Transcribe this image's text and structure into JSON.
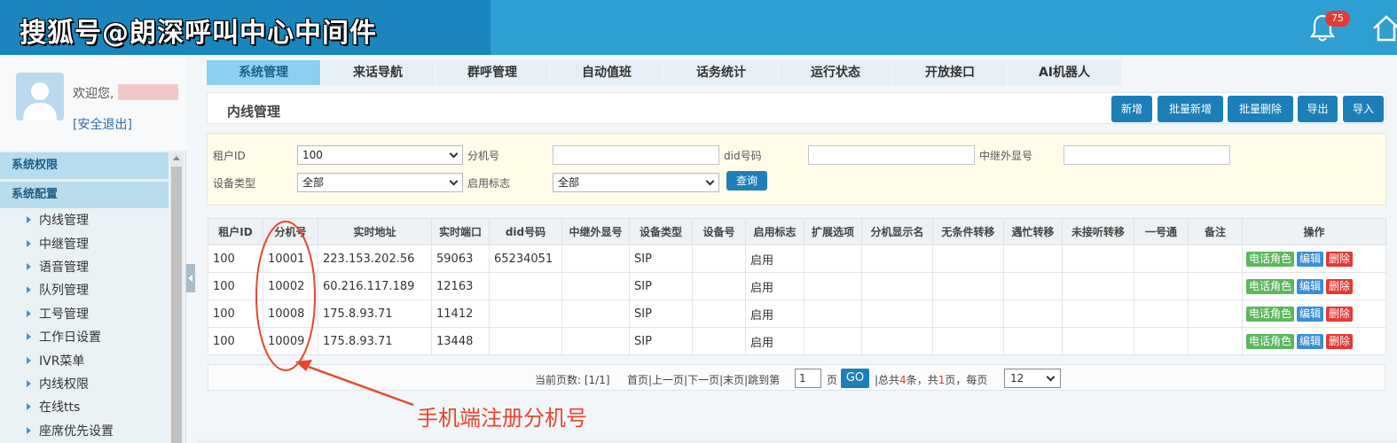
{
  "watermark": "搜狐号@朗深呼叫中心中间件",
  "notifications": {
    "count": "75"
  },
  "user": {
    "welcome": "欢迎您,",
    "logout": "[安全退出]"
  },
  "sidebar": {
    "sections": [
      "系统权限",
      "系统配置"
    ],
    "items": [
      "内线管理",
      "中继管理",
      "语音管理",
      "队列管理",
      "工号管理",
      "工作日设置",
      "IVR菜单",
      "内线权限",
      "在线tts",
      "座席优先设置"
    ]
  },
  "tabs": [
    "系统管理",
    "来话导航",
    "群呼管理",
    "自动值班",
    "话务统计",
    "运行状态",
    "开放接口",
    "AI机器人"
  ],
  "panel": {
    "title": "内线管理"
  },
  "toolbar": {
    "add": "新增",
    "batch_add": "批量新增",
    "batch_delete": "批量删除",
    "export": "导出",
    "import": "导入"
  },
  "filter": {
    "tenant_label": "租户ID",
    "tenant_value": "100",
    "ext_label": "分机号",
    "did_label": "did号码",
    "trunk_label": "中继外显号",
    "device_label": "设备类型",
    "device_value": "全部",
    "enable_label": "启用标志",
    "enable_value": "全部",
    "query": "查询"
  },
  "table": {
    "headers": [
      "租户ID",
      "分机号",
      "实时地址",
      "实时端口",
      "did号码",
      "中继外显号",
      "设备类型",
      "设备号",
      "启用标志",
      "扩展选项",
      "分机显示名",
      "无条件转移",
      "遇忙转移",
      "未接听转移",
      "一号通",
      "备注",
      "操作"
    ],
    "rows": [
      [
        "100",
        "10001",
        "223.153.202.56",
        "59063",
        "65234051",
        "",
        "SIP",
        "",
        "启用",
        "",
        "",
        "",
        "",
        "",
        "",
        ""
      ],
      [
        "100",
        "10002",
        "60.216.117.189",
        "12163",
        "",
        "",
        "SIP",
        "",
        "启用",
        "",
        "",
        "",
        "",
        "",
        "",
        ""
      ],
      [
        "100",
        "10008",
        "175.8.93.71",
        "11412",
        "",
        "",
        "SIP",
        "",
        "启用",
        "",
        "",
        "",
        "",
        "",
        "",
        ""
      ],
      [
        "100",
        "10009",
        "175.8.93.71",
        "13448",
        "",
        "",
        "SIP",
        "",
        "启用",
        "",
        "",
        "",
        "",
        "",
        "",
        ""
      ]
    ],
    "actions": {
      "role": "电话角色",
      "edit": "编辑",
      "delete": "删除"
    }
  },
  "pager": {
    "current": "当前页数: [1/1]",
    "nav": "首页|上一页|下一页|末页|跳到第",
    "page_input": "1",
    "page_unit": "页",
    "go": "GO",
    "total_prefix": "|总共",
    "total_count": "4",
    "total_mid": "条，共",
    "total_pages": "1",
    "total_suffix": "页，每页",
    "page_size": "12"
  },
  "annotation": "手机端注册分机号"
}
